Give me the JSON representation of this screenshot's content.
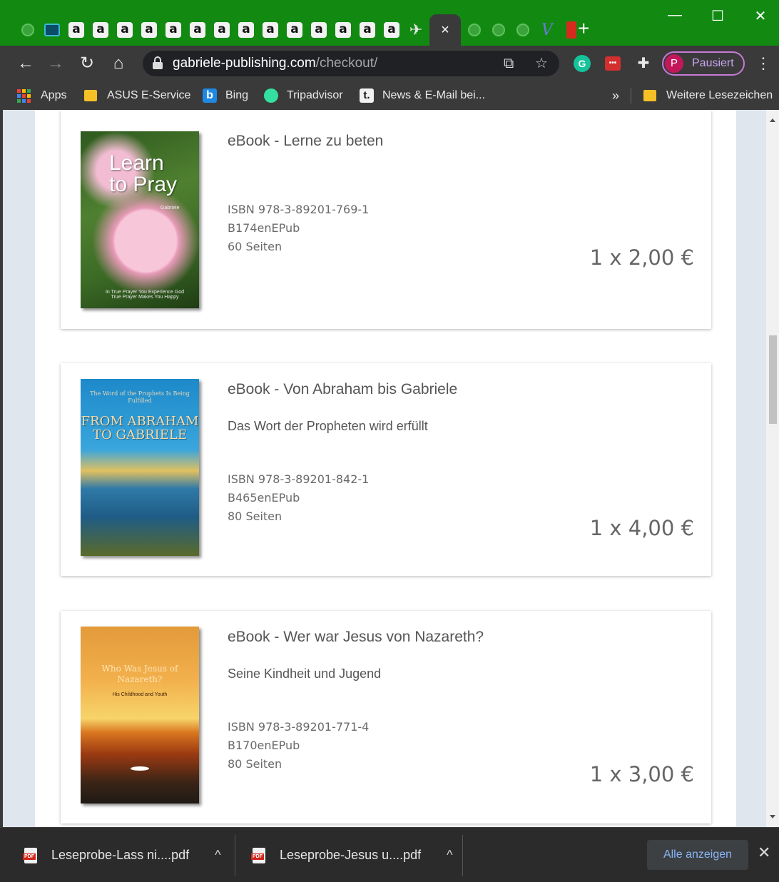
{
  "window": {
    "controls": [
      "—",
      "☐",
      "✕"
    ]
  },
  "tabs": {
    "amazon_glyph": "a",
    "active_close": "×",
    "newtab": "+",
    "v_glyph": "V"
  },
  "toolbar": {
    "url_host": "gabriele-publishing.com",
    "url_path": "/checkout/",
    "profile_initial": "P",
    "profile_label": "Pausiert",
    "grammarly_glyph": "G"
  },
  "bookmarks": {
    "items": [
      {
        "label": "Apps"
      },
      {
        "label": "ASUS E-Service"
      },
      {
        "label": "Bing"
      },
      {
        "label": "Tripadvisor"
      },
      {
        "label": "News & E-Mail bei..."
      }
    ],
    "t_glyph": "t.",
    "b_glyph": "b",
    "overflow": "»",
    "other_label": "Weitere Lesezeichen"
  },
  "products": [
    {
      "title": "eBook - Lerne zu beten",
      "subtitle": "",
      "isbn": "ISBN 978-3-89201-769-1",
      "code": "B174enEPub",
      "pages": "60 Seiten",
      "price": "1 x  2,00 €",
      "cover_title_1": "Learn",
      "cover_title_2": "to Pray",
      "cover_author": "Gabriele",
      "cover_tagline": "In True Prayer You Experience God True Prayer Makes You Happy"
    },
    {
      "title": "eBook - Von Abraham bis Gabriele",
      "subtitle": "Das Wort der Propheten wird erfüllt",
      "isbn": "ISBN 978-3-89201-842-1",
      "code": "B465enEPub",
      "pages": "80 Seiten",
      "price": "1 x  4,00 €",
      "cover_top": "The Word of the Prophets Is Being Fulfilled",
      "cover_title": "FROM ABRAHAM TO GABRIELE"
    },
    {
      "title": "eBook - Wer war Jesus von Nazareth?",
      "subtitle": "Seine Kindheit und Jugend",
      "isbn": "ISBN 978-3-89201-771-4",
      "code": "B170enEPub",
      "pages": "80 Seiten",
      "price": "1 x  3,00 €",
      "cover_title": "Who Was Jesus of Nazareth?",
      "cover_sub": "His Childhood and Youth"
    }
  ],
  "downloads": {
    "items": [
      {
        "name": "Leseprobe-Lass ni....pdf"
      },
      {
        "name": "Leseprobe-Jesus u....pdf"
      }
    ],
    "pdf_badge": "PDF",
    "chevron": "^",
    "show_all": "Alle anzeigen",
    "close": "✕"
  },
  "colors": {
    "tabstrip": "#128a12",
    "toolbar": "#3a3a3a",
    "page_bg": "#dfe6ee",
    "link_blue": "#8ab4f8"
  }
}
